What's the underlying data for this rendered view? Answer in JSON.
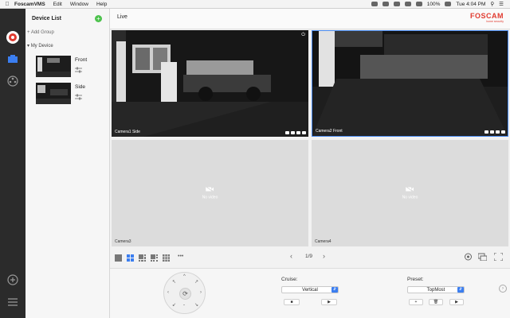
{
  "menubar": {
    "apple": "",
    "items": [
      "FoscamVMS",
      "Edit",
      "Window",
      "Help"
    ],
    "battery": "100%",
    "time": "Tue 4:04 PM"
  },
  "device_list": {
    "title": "Device List",
    "add_group": "+ Add Group",
    "group_name": "My Device",
    "devices": [
      {
        "name": "Front"
      },
      {
        "name": "Side"
      }
    ]
  },
  "live": {
    "title": "Live",
    "logo_brand": "FOSCAM",
    "logo_tagline": "home security"
  },
  "cameras": [
    {
      "label": "Camera1 Side",
      "has_video": true
    },
    {
      "label": "Camera2 Front",
      "has_video": true,
      "selected": true
    },
    {
      "label": "Camera3",
      "has_video": false,
      "no_video_text": "No video"
    },
    {
      "label": "Camera4",
      "has_video": false,
      "no_video_text": "No video"
    }
  ],
  "toolbar": {
    "page_indicator": "1/9",
    "more": "•••"
  },
  "ptz": {
    "cruise_label": "Cruise:",
    "cruise_value": "Vertical",
    "preset_label": "Preset:",
    "preset_value": "TopMost"
  },
  "colors": {
    "accent": "#3b7ef0",
    "brand": "#e03a2f",
    "add": "#4cc24c",
    "dock": "#2b2b2b"
  }
}
